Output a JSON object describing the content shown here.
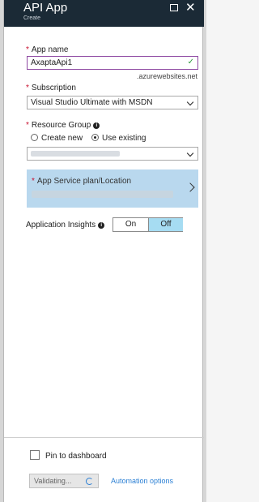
{
  "header": {
    "title": "API App",
    "subtitle": "Create"
  },
  "app_name": {
    "label": "App name",
    "value": "AxaptaApi1",
    "suffix": ".azurewebsites.net"
  },
  "subscription": {
    "label": "Subscription",
    "value": "Visual Studio Ultimate with MSDN"
  },
  "resource_group": {
    "label": "Resource Group",
    "option_new": "Create new",
    "option_existing": "Use existing",
    "selected": "Use existing"
  },
  "plan": {
    "label": "App Service plan/Location"
  },
  "insights": {
    "label": "Application Insights",
    "on": "On",
    "off": "Off",
    "selected": "Off"
  },
  "footer": {
    "pin_label": "Pin to dashboard",
    "validate_label": "Validating...",
    "automation_label": "Automation options"
  },
  "colors": {
    "header_bg": "#1b2a36",
    "required": "#c8102e",
    "plan_bg": "#b9d8ee",
    "toggle_selected": "#a6dcf2",
    "link": "#2a7fd4",
    "valid_check": "#2b9a3a"
  }
}
